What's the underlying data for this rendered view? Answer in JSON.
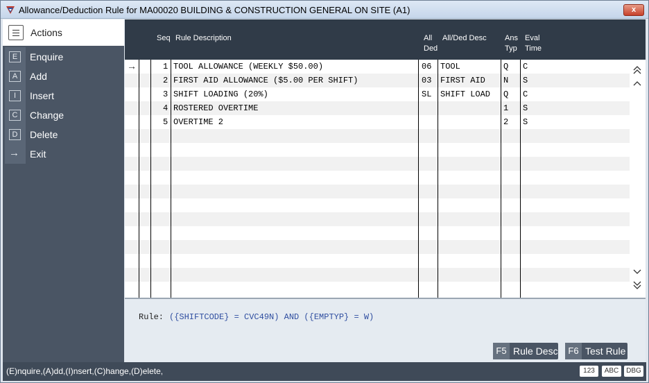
{
  "window": {
    "title": "Allowance/Deduction Rule for  MA00020 BUILDING & CONSTRUCTION GENERAL ON SITE (A1)",
    "close_label": "x"
  },
  "sidebar": {
    "header": "Actions",
    "items": [
      {
        "key": "E",
        "label": "Enquire"
      },
      {
        "key": "A",
        "label": "Add"
      },
      {
        "key": "I",
        "label": "Insert"
      },
      {
        "key": "C",
        "label": "Change"
      },
      {
        "key": "D",
        "label": "Delete"
      },
      {
        "key": "→",
        "label": "Exit"
      }
    ]
  },
  "grid": {
    "headers": {
      "seq": "Seq",
      "rule_desc": "Rule Description",
      "all_ded_1": "All",
      "all_ded_2": "Ded",
      "all_ded_desc": "All/Ded Desc",
      "ans_typ_1": "Ans",
      "ans_typ_2": "Typ",
      "eval_time_1": "Eval",
      "eval_time_2": "Time"
    },
    "rows": [
      {
        "seq": "1",
        "desc": "TOOL ALLOWANCE (WEEKLY $50.00)",
        "code": "06",
        "code_desc": "TOOL",
        "ans": "Q",
        "eval": "C"
      },
      {
        "seq": "2",
        "desc": "FIRST AID ALLOWANCE ($5.00 PER SHIFT)",
        "code": "03",
        "code_desc": "FIRST AID",
        "ans": "N",
        "eval": "S"
      },
      {
        "seq": "3",
        "desc": "SHIFT LOADING (20%)",
        "code": "SL",
        "code_desc": "SHIFT LOAD",
        "ans": "Q",
        "eval": "C"
      },
      {
        "seq": "4",
        "desc": "ROSTERED OVERTIME",
        "code": "",
        "code_desc": "",
        "ans": "1",
        "eval": "S"
      },
      {
        "seq": "5",
        "desc": "OVERTIME 2",
        "code": "",
        "code_desc": "",
        "ans": "2",
        "eval": "S"
      }
    ],
    "current_row_marker": "→"
  },
  "rule": {
    "label": "Rule:",
    "text": "({SHIFTCODE} = CVC49N) AND ({EMPTYP} = W)"
  },
  "buttons": {
    "f5_key": "F5",
    "f5_label": "Rule Desc",
    "f6_key": "F6",
    "f6_label": "Test Rule"
  },
  "status": {
    "text": "(E)nquire,(A)dd,(I)nsert,(C)hange,(D)elete,",
    "badges": [
      "123",
      "ABC",
      "DBG"
    ]
  },
  "colors": {
    "sidebar": "#4a5564",
    "header": "#303b48",
    "rule_text": "#2f4ea0"
  }
}
